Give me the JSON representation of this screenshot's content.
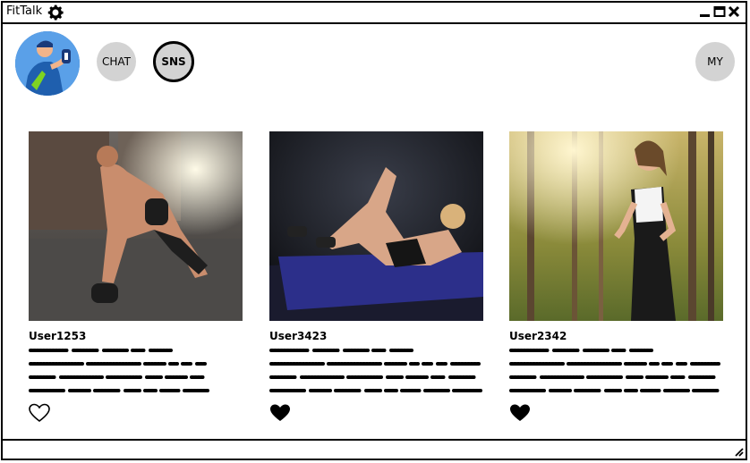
{
  "window": {
    "title": "FitTalk"
  },
  "nav": {
    "chat_label": "CHAT",
    "sns_label": "SNS",
    "my_label": "MY",
    "active": "SNS"
  },
  "posts": [
    {
      "username": "User1253",
      "liked": false,
      "photo": "push-up workout photo"
    },
    {
      "username": "User3423",
      "liked": true,
      "photo": "crunches on mat photo"
    },
    {
      "username": "User2342",
      "liked": true,
      "photo": "woman jogging in forest photo"
    }
  ],
  "colors": {
    "pill_bg": "#d3d3d3",
    "border": "#000000",
    "avatar_bg": "#4a90d9"
  }
}
